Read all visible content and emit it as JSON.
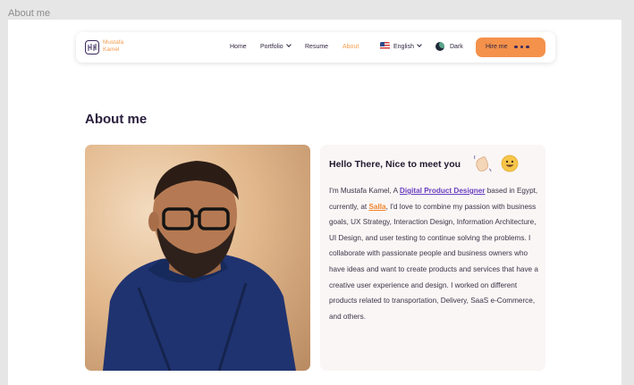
{
  "frame_label": "About me",
  "brand": {
    "line1": "Mustafa",
    "line2": "Kamel"
  },
  "nav": {
    "home": "Home",
    "portfolio": "Portfolio",
    "resume": "Resume",
    "about": "About",
    "language": "English",
    "theme": "Dark",
    "hire": "Hire me"
  },
  "section_title": "About me",
  "intro": {
    "title": "Hello There, Nice to meet you",
    "p1": "I'm Mustafa Kamel, A ",
    "role": "Digital Product Designer",
    "p2": " based in Egypt, currently, at ",
    "company": "Salla",
    "p3": ", I'd love to combine my passion with business goals, UX Strategy, Interaction Design, Information Architecture, UI Design, and user testing to continue solving the problems. I collaborate with passionate people and business owners who have ideas and want to create products and services that have a creative user experience and design. I worked on different products related to transportation, Delivery, SaaS e-Commerce, and others."
  },
  "colors": {
    "accent": "#f4914b",
    "brand_dark": "#2a1f3d",
    "highlight": "#6a3fc0",
    "card_bg": "#faf6f5"
  },
  "icons": {
    "logo": "mk-logo-icon",
    "flag": "us-flag-icon",
    "theme": "moon-icon",
    "wave": "waving-hand-icon",
    "smile": "smiling-face-icon"
  }
}
